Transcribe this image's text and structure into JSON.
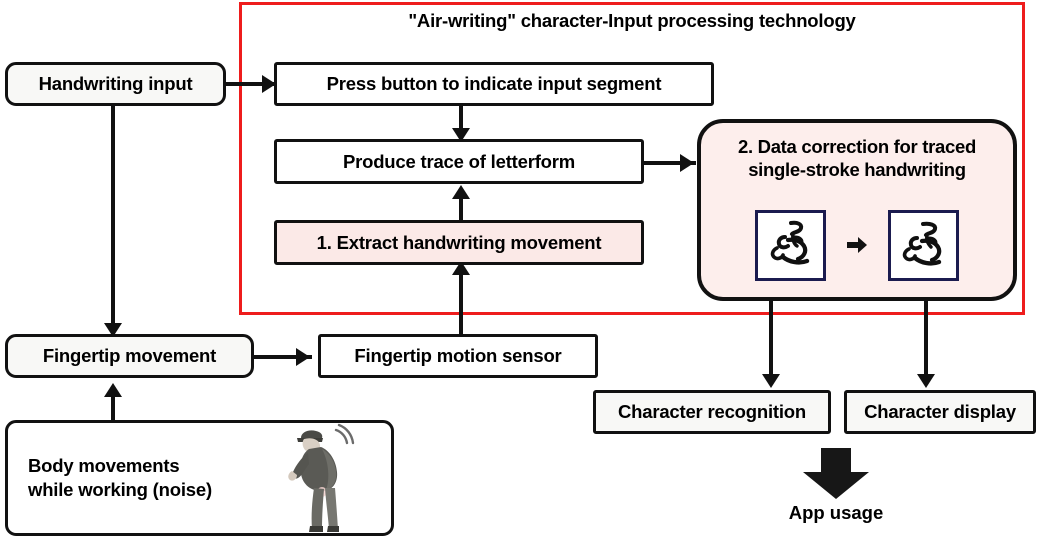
{
  "region": {
    "title": "\"Air-writing\" character-Input processing technology",
    "border_color": "#ee1c1c"
  },
  "colors": {
    "accent_red": "#ee1c1c",
    "box_border": "#111111",
    "pink_fill": "#fdeeec",
    "pink_node_fill": "#fbe9e7",
    "sample_border": "#1b1b4f",
    "box_fill": "#f8f8f6"
  },
  "nodes": {
    "handwriting_input": "Handwriting input",
    "press_button": "Press button to indicate input segment",
    "produce_trace": "Produce trace of letterform",
    "extract_movement": "1. Extract handwriting movement",
    "data_correction": "2. Data correction for traced single-stroke handwriting",
    "data_correction_line1": "2. Data correction for traced",
    "data_correction_line2": "single-stroke handwriting",
    "fingertip_movement": "Fingertip movement",
    "fingertip_sensor": "Fingertip motion sensor",
    "body_movements_line1": "Body movements",
    "body_movements_line2": "while working (noise)",
    "character_recognition": "Character recognition",
    "character_display": "Character display",
    "app_usage": "App usage"
  },
  "samples": {
    "before_label": "traced single-stroke handwriting sample (raw)",
    "after_label": "traced single-stroke handwriting sample (corrected)",
    "transform_arrow": "right-arrow"
  },
  "illustration": {
    "worker_label": "worker bending while working",
    "motion_waves": "motion wave arcs"
  },
  "flow": [
    {
      "from": "Handwriting input",
      "to": "Press button to indicate input segment"
    },
    {
      "from": "Handwriting input",
      "to": "Fingertip movement"
    },
    {
      "from": "Press button to indicate input segment",
      "to": "Produce trace of letterform"
    },
    {
      "from": "1. Extract handwriting movement",
      "to": "Produce trace of letterform"
    },
    {
      "from": "Produce trace of letterform",
      "to": "2. Data correction for traced single-stroke handwriting"
    },
    {
      "from": "Fingertip movement",
      "to": "Fingertip motion sensor"
    },
    {
      "from": "Fingertip motion sensor",
      "to": "1. Extract handwriting movement"
    },
    {
      "from": "Body movements while working (noise)",
      "to": "Fingertip movement"
    },
    {
      "from": "2. Data correction for traced single-stroke handwriting",
      "to": "Character recognition"
    },
    {
      "from": "2. Data correction for traced single-stroke handwriting",
      "to": "Character display"
    },
    {
      "from": "Character recognition / Character display",
      "to": "App usage"
    }
  ]
}
